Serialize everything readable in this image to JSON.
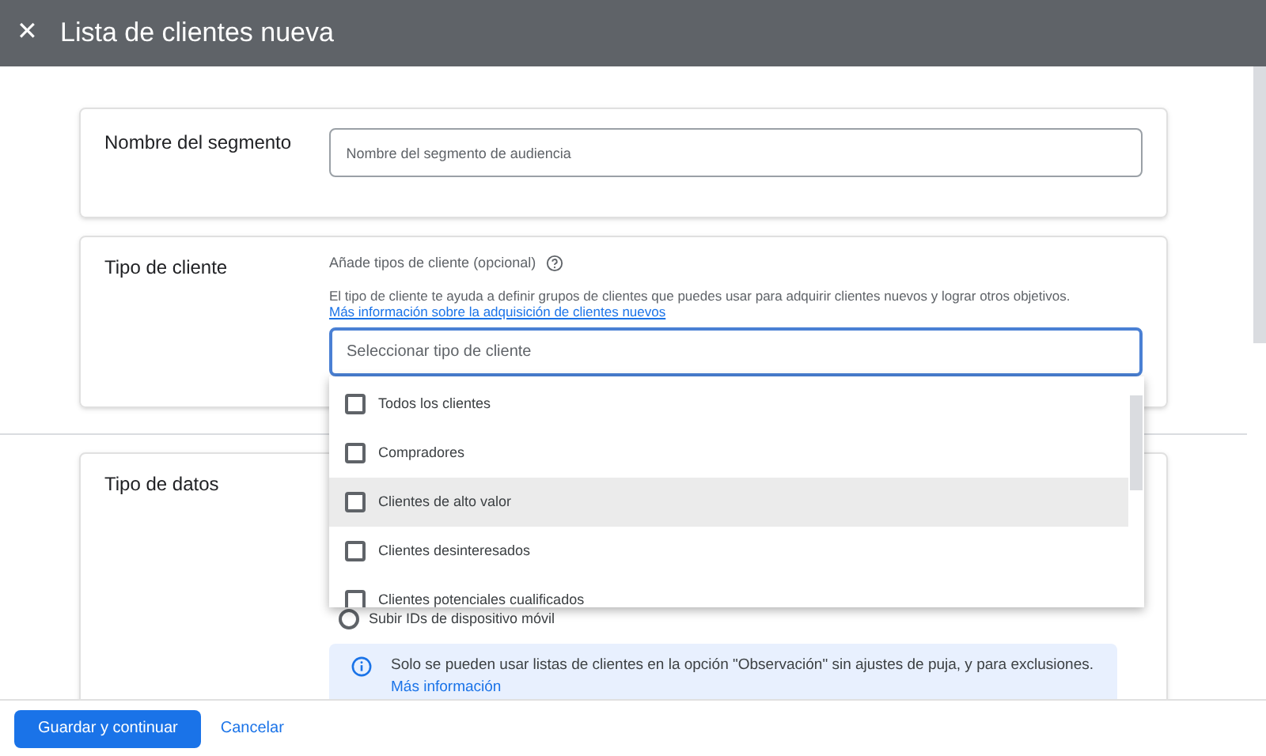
{
  "header": {
    "close": "✕",
    "title": "Lista de clientes nueva"
  },
  "segment": {
    "label": "Nombre del segmento",
    "placeholder": "Nombre del segmento de audiencia"
  },
  "customer_type": {
    "label": "Tipo de cliente",
    "hint": "Añade tipos de cliente (opcional)",
    "description": "El tipo de cliente te ayuda a definir grupos de clientes que puedes usar para adquirir clientes nuevos y lograr otros objetivos.",
    "link": "Más información sobre la adquisición de clientes nuevos",
    "placeholder": "Seleccionar tipo de cliente",
    "options": [
      {
        "label": "Todos los clientes",
        "checked": false,
        "highlighted": false
      },
      {
        "label": "Compradores",
        "checked": false,
        "highlighted": false
      },
      {
        "label": "Clientes de alto valor",
        "checked": false,
        "highlighted": true
      },
      {
        "label": "Clientes desinteresados",
        "checked": false,
        "highlighted": false
      },
      {
        "label": "Clientes potenciales cualificados",
        "checked": false,
        "highlighted": false
      }
    ]
  },
  "data_type": {
    "label": "Tipo de datos",
    "radio": {
      "label": "Subir IDs de dispositivo móvil",
      "selected": false
    },
    "info": "Solo se pueden usar listas de clientes en la opción \"Observación\" sin ajustes de puja, y para exclusiones.",
    "info_link": "Más información"
  },
  "footer": {
    "save": "Guardar y continuar",
    "cancel": "Cancelar"
  }
}
